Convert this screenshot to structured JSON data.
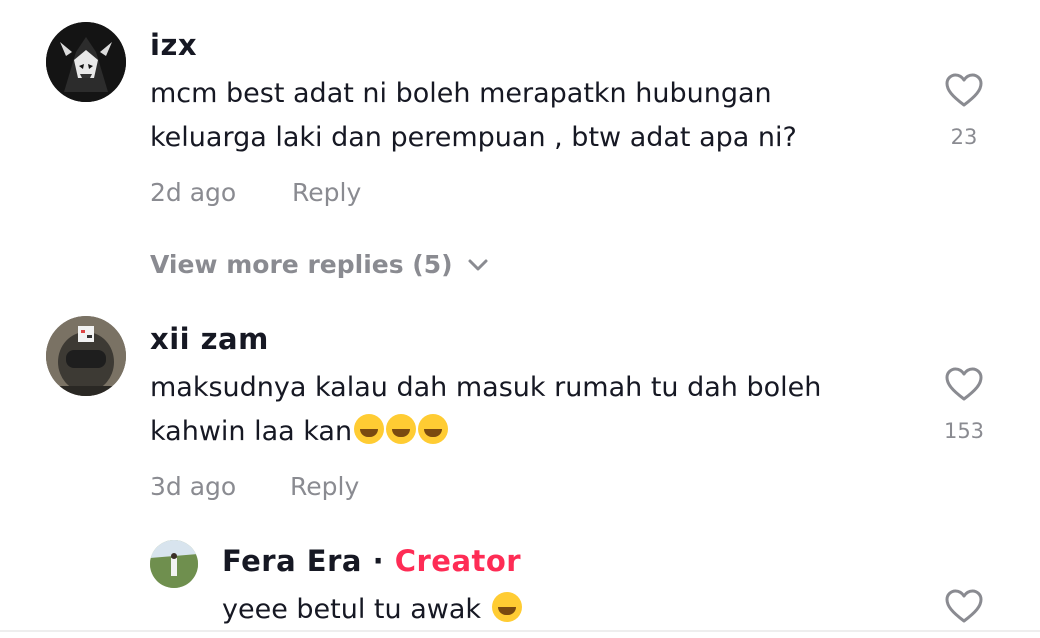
{
  "comments": [
    {
      "username": "izx",
      "text_line1": "mcm best adat ni boleh merapatkn hubungan",
      "text_line2": "keluarga laki dan perempuan , btw adat apa ni?",
      "time": "2d ago",
      "reply_label": "Reply",
      "likes": "23"
    },
    {
      "username": "xii zam",
      "text_line1": "maksudnya kalau dah masuk rumah tu dah boleh",
      "text_line2": "kahwin laa kan",
      "emojis": "grinning-sweat",
      "time": "3d ago",
      "reply_label": "Reply",
      "likes": "153"
    }
  ],
  "view_more": "View more replies (5)",
  "reply": {
    "username": "Fera Era",
    "separator": "·",
    "badge": "Creator",
    "text": "yeee betul tu awak",
    "emoji": "beaming-face"
  },
  "colors": {
    "accent": "#fe2c55",
    "muted": "#8a8b91",
    "text": "#161823"
  }
}
